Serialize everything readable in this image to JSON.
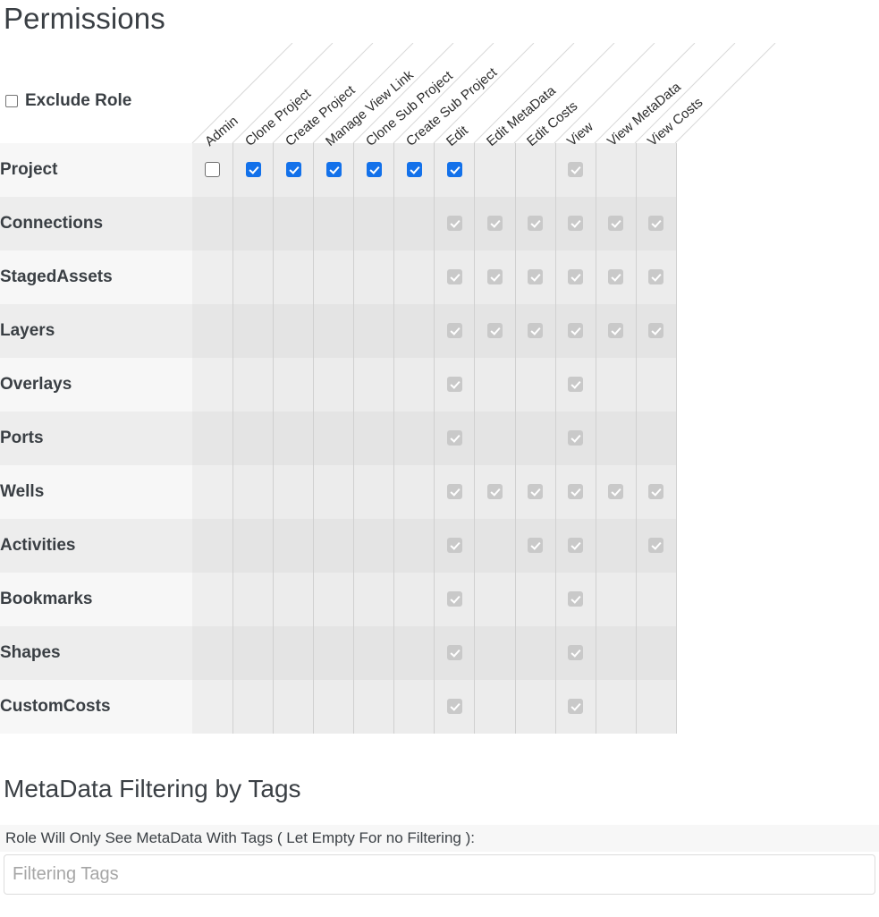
{
  "page_title": "Permissions",
  "exclude_role": {
    "label": "Exclude Role",
    "checked": false
  },
  "matrix": {
    "columns": [
      "Admin",
      "Clone Project",
      "Create Project",
      "Manage View Link",
      "Clone Sub Project",
      "Create Sub Project",
      "Edit",
      "Edit MetaData",
      "Edit Costs",
      "View",
      "View MetaData",
      "View Costs"
    ],
    "rows": [
      {
        "name": "Project",
        "states": [
          "empty",
          "on",
          "on",
          "on",
          "on",
          "on",
          "on",
          "none",
          "none",
          "dis",
          "none",
          "none"
        ]
      },
      {
        "name": "Connections",
        "states": [
          "none",
          "none",
          "none",
          "none",
          "none",
          "none",
          "dis",
          "dis",
          "dis",
          "dis",
          "dis",
          "dis"
        ]
      },
      {
        "name": "StagedAssets",
        "states": [
          "none",
          "none",
          "none",
          "none",
          "none",
          "none",
          "dis",
          "dis",
          "dis",
          "dis",
          "dis",
          "dis"
        ]
      },
      {
        "name": "Layers",
        "states": [
          "none",
          "none",
          "none",
          "none",
          "none",
          "none",
          "dis",
          "dis",
          "dis",
          "dis",
          "dis",
          "dis"
        ]
      },
      {
        "name": "Overlays",
        "states": [
          "none",
          "none",
          "none",
          "none",
          "none",
          "none",
          "dis",
          "none",
          "none",
          "dis",
          "none",
          "none"
        ]
      },
      {
        "name": "Ports",
        "states": [
          "none",
          "none",
          "none",
          "none",
          "none",
          "none",
          "dis",
          "none",
          "none",
          "dis",
          "none",
          "none"
        ]
      },
      {
        "name": "Wells",
        "states": [
          "none",
          "none",
          "none",
          "none",
          "none",
          "none",
          "dis",
          "dis",
          "dis",
          "dis",
          "dis",
          "dis"
        ]
      },
      {
        "name": "Activities",
        "states": [
          "none",
          "none",
          "none",
          "none",
          "none",
          "none",
          "dis",
          "none",
          "dis",
          "dis",
          "none",
          "dis"
        ]
      },
      {
        "name": "Bookmarks",
        "states": [
          "none",
          "none",
          "none",
          "none",
          "none",
          "none",
          "dis",
          "none",
          "none",
          "dis",
          "none",
          "none"
        ]
      },
      {
        "name": "Shapes",
        "states": [
          "none",
          "none",
          "none",
          "none",
          "none",
          "none",
          "dis",
          "none",
          "none",
          "dis",
          "none",
          "none"
        ]
      },
      {
        "name": "CustomCosts",
        "states": [
          "none",
          "none",
          "none",
          "none",
          "none",
          "none",
          "dis",
          "none",
          "none",
          "dis",
          "none",
          "none"
        ]
      }
    ]
  },
  "metadata_filtering": {
    "title": "MetaData Filtering by Tags",
    "label": "Role Will Only See MetaData With Tags ( Let Empty For no Filtering ):",
    "input_value": "",
    "input_placeholder": "Filtering Tags"
  },
  "colors": {
    "checked": "#1371ea",
    "disabled_check": "#c9c9c9",
    "text": "#3a3f44",
    "grid_line": "#d0d0d0"
  }
}
